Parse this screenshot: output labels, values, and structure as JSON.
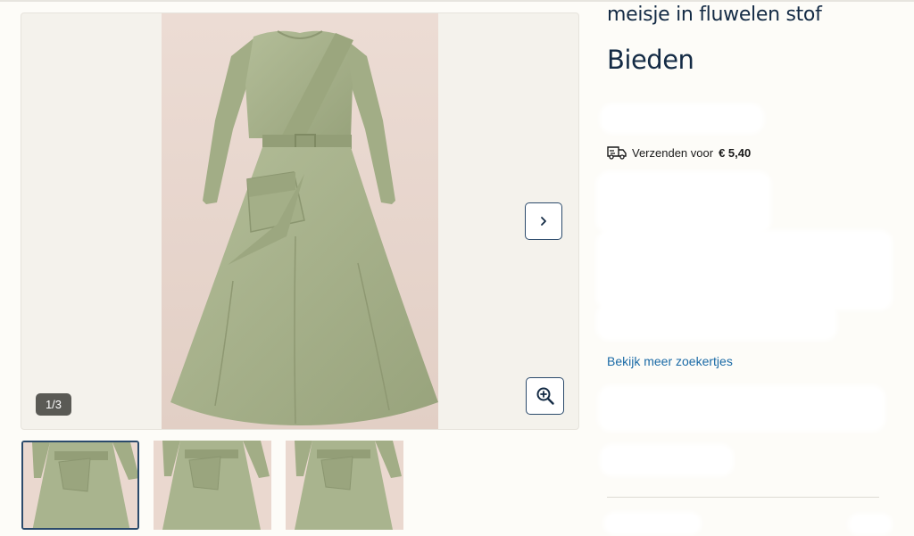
{
  "listing": {
    "title": "meisje in fluwelen stof",
    "price": "Bieden"
  },
  "gallery": {
    "counter": "1/3",
    "next_icon": "chevron-right-icon",
    "zoom_icon": "zoom-in-icon",
    "thumbnail_count": 3,
    "active_thumbnail": 1
  },
  "shipping": {
    "icon": "truck-icon",
    "label": "Verzenden voor",
    "price": "€ 5,40"
  },
  "links": {
    "more_listings": "Bekijk meer zoekertjes"
  },
  "colors": {
    "title": "#142b45",
    "link": "#1a6aa6",
    "accent_border": "#2b4a6b",
    "dress": "#a9b48e"
  }
}
